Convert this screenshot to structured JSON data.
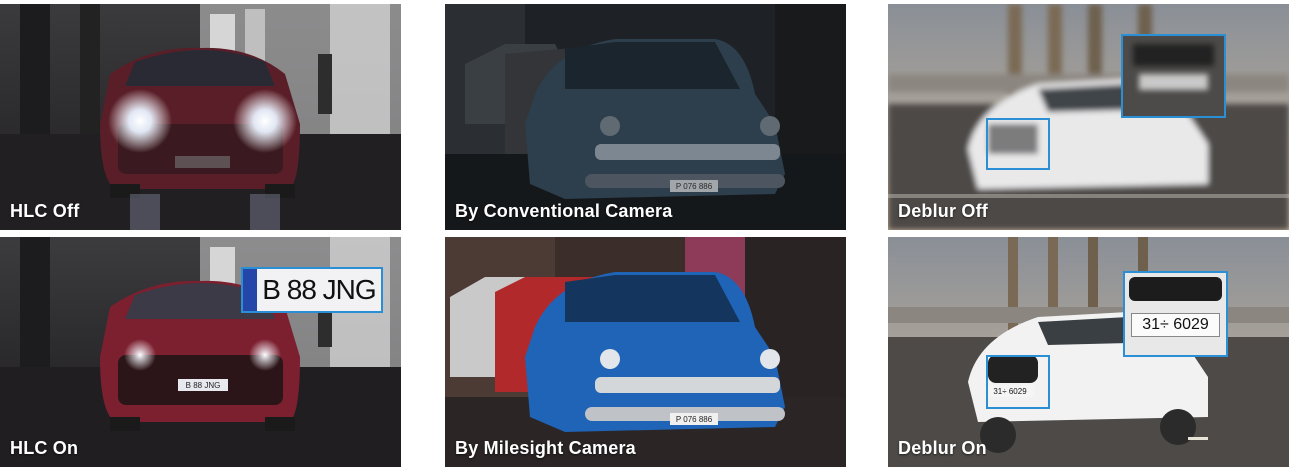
{
  "tiles": {
    "hlc_off": {
      "caption": "HLC Off"
    },
    "hlc_on": {
      "caption": "HLC On",
      "zoom_plate": "B 88 JNG",
      "small_plate": "B 88 JNG"
    },
    "conventional": {
      "caption": "By Conventional Camera",
      "plate": "P 076 886"
    },
    "milesight": {
      "caption": "By Milesight Camera",
      "plate": "P 076 886"
    },
    "deblur_off": {
      "caption": "Deblur Off"
    },
    "deblur_on": {
      "caption": "Deblur On",
      "zoom_plate": "31÷ 6029",
      "small_plate": "31÷ 6029"
    }
  },
  "colors": {
    "accent": "#2b8fd6"
  }
}
